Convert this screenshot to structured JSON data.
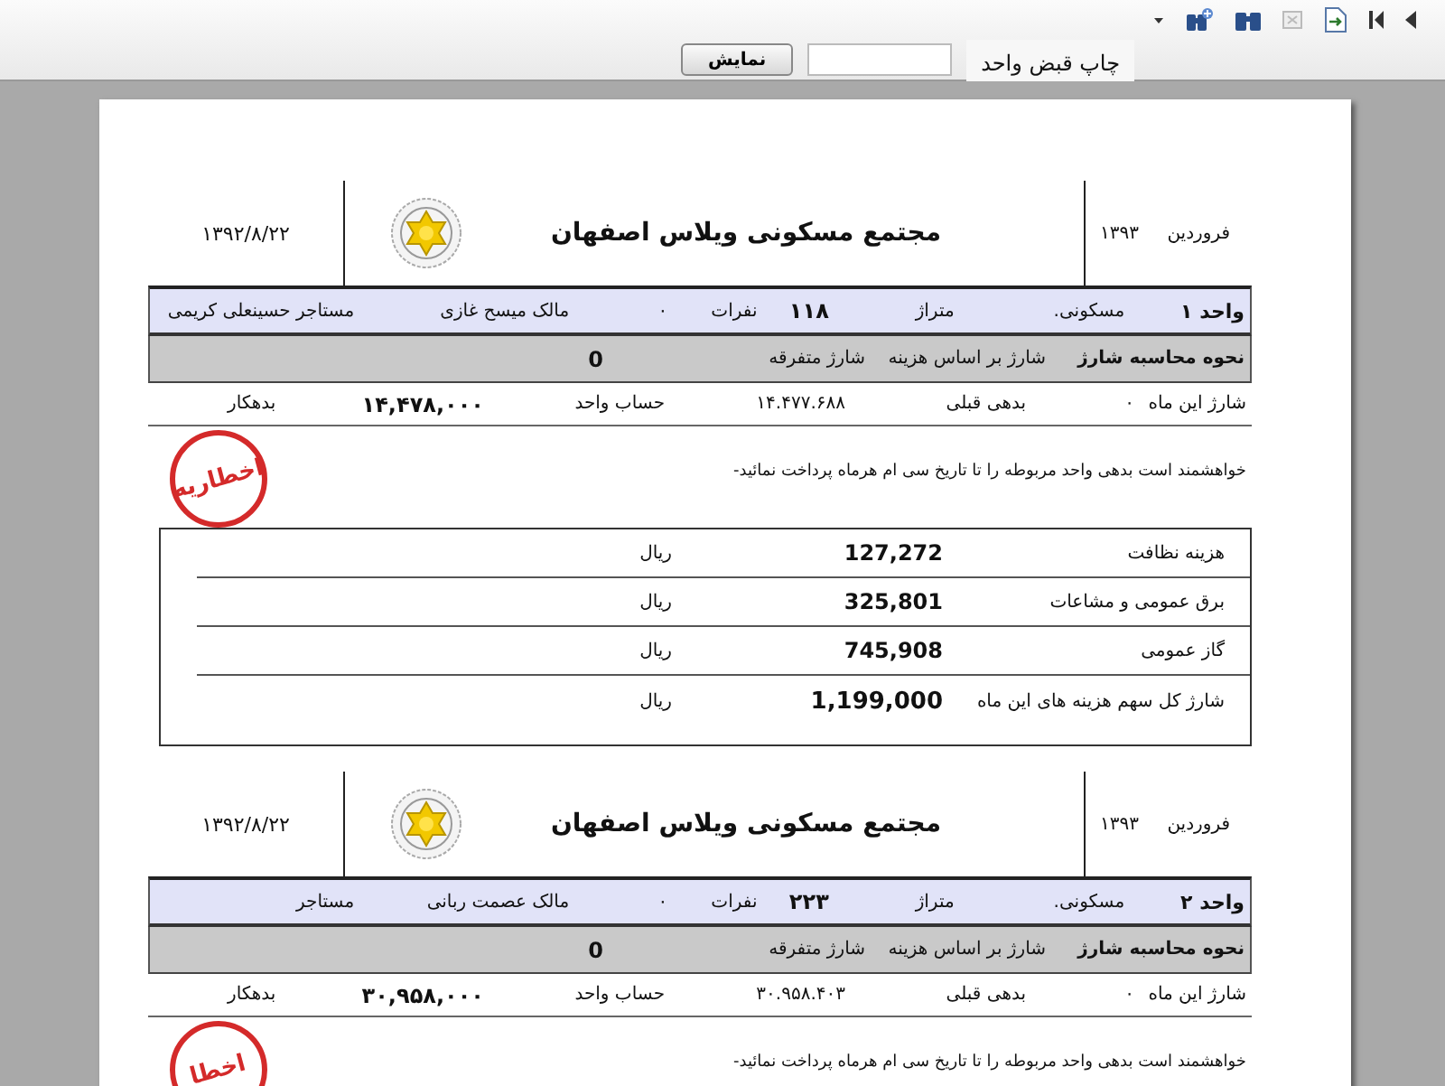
{
  "parameters": {
    "label": "چاپ قبض واحد",
    "button": "نمایش"
  },
  "receipts": [
    {
      "header": {
        "month": "فروردین",
        "year": "۱۳۹۳",
        "title": "مجتمع مسکونی ویلاس اصفهان",
        "date": "۱۳۹۲/۸/۲۲"
      },
      "unit": {
        "unit": "واحد ۱",
        "type": "مسکونی.",
        "area_label": "متراژ",
        "area": "۱۱۸",
        "people_label": "نفرات",
        "people": "۰",
        "owner": "مالک  میسح  غازی",
        "tenant": "مستاجر حسینعلی کریمی"
      },
      "calc": {
        "label": "نحوه محاسبه شارژ",
        "method": "شارژ بر اساس هزینه",
        "misc_label": "شارژ متفرقه",
        "misc": "0"
      },
      "balance": {
        "charge_label": "شارژ  این ماه",
        "charge": "۰",
        "prev_label": "بدهی قبلی",
        "prev": "۱۴.۴۷۷.۶۸۸",
        "account_label": "حساب واحد",
        "account": "۱۴,۴۷۸,۰۰۰",
        "status": "بدهکار"
      },
      "stamp": "اخطاریه",
      "notice": "خواهشمند است بدهی واحد مربوطه را تا تاریخ سی ام هرماه پرداخت نمائید-",
      "costs": [
        {
          "kind": "item",
          "label": "هزینه نظافت",
          "amount": "127,272",
          "currency": "ریال"
        },
        {
          "kind": "item",
          "label": "برق عمومی و مشاعات",
          "amount": "325,801",
          "currency": "ریال"
        },
        {
          "kind": "item",
          "label": "گاز عمومی",
          "amount": "745,908",
          "currency": "ریال"
        },
        {
          "kind": "total",
          "label": "شارژ کل سهم هزینه های این ماه",
          "amount": "1,199,000",
          "currency": "ریال"
        }
      ]
    },
    {
      "header": {
        "month": "فروردین",
        "year": "۱۳۹۳",
        "title": "مجتمع مسکونی ویلاس اصفهان",
        "date": "۱۳۹۲/۸/۲۲"
      },
      "unit": {
        "unit": "واحد ۲",
        "type": "مسکونی.",
        "area_label": "متراژ",
        "area": "۲۲۳",
        "people_label": "نفرات",
        "people": "۰",
        "owner": "مالک  عصمت ربانی",
        "tenant": "مستاجر"
      },
      "calc": {
        "label": "نحوه محاسبه شارژ",
        "method": "شارژ بر اساس هزینه",
        "misc_label": "شارژ متفرقه",
        "misc": "0"
      },
      "balance": {
        "charge_label": "شارژ  این ماه",
        "charge": "۰",
        "prev_label": "بدهی قبلی",
        "prev": "۳۰.۹۵۸.۴۰۳",
        "account_label": "حساب واحد",
        "account": "۳۰,۹۵۸,۰۰۰",
        "status": "بدهکار"
      },
      "stamp": "اخطا",
      "notice": "خواهشمند است بدهی واحد مربوطه را تا تاریخ سی ام هرماه پرداخت نمائید-"
    }
  ]
}
